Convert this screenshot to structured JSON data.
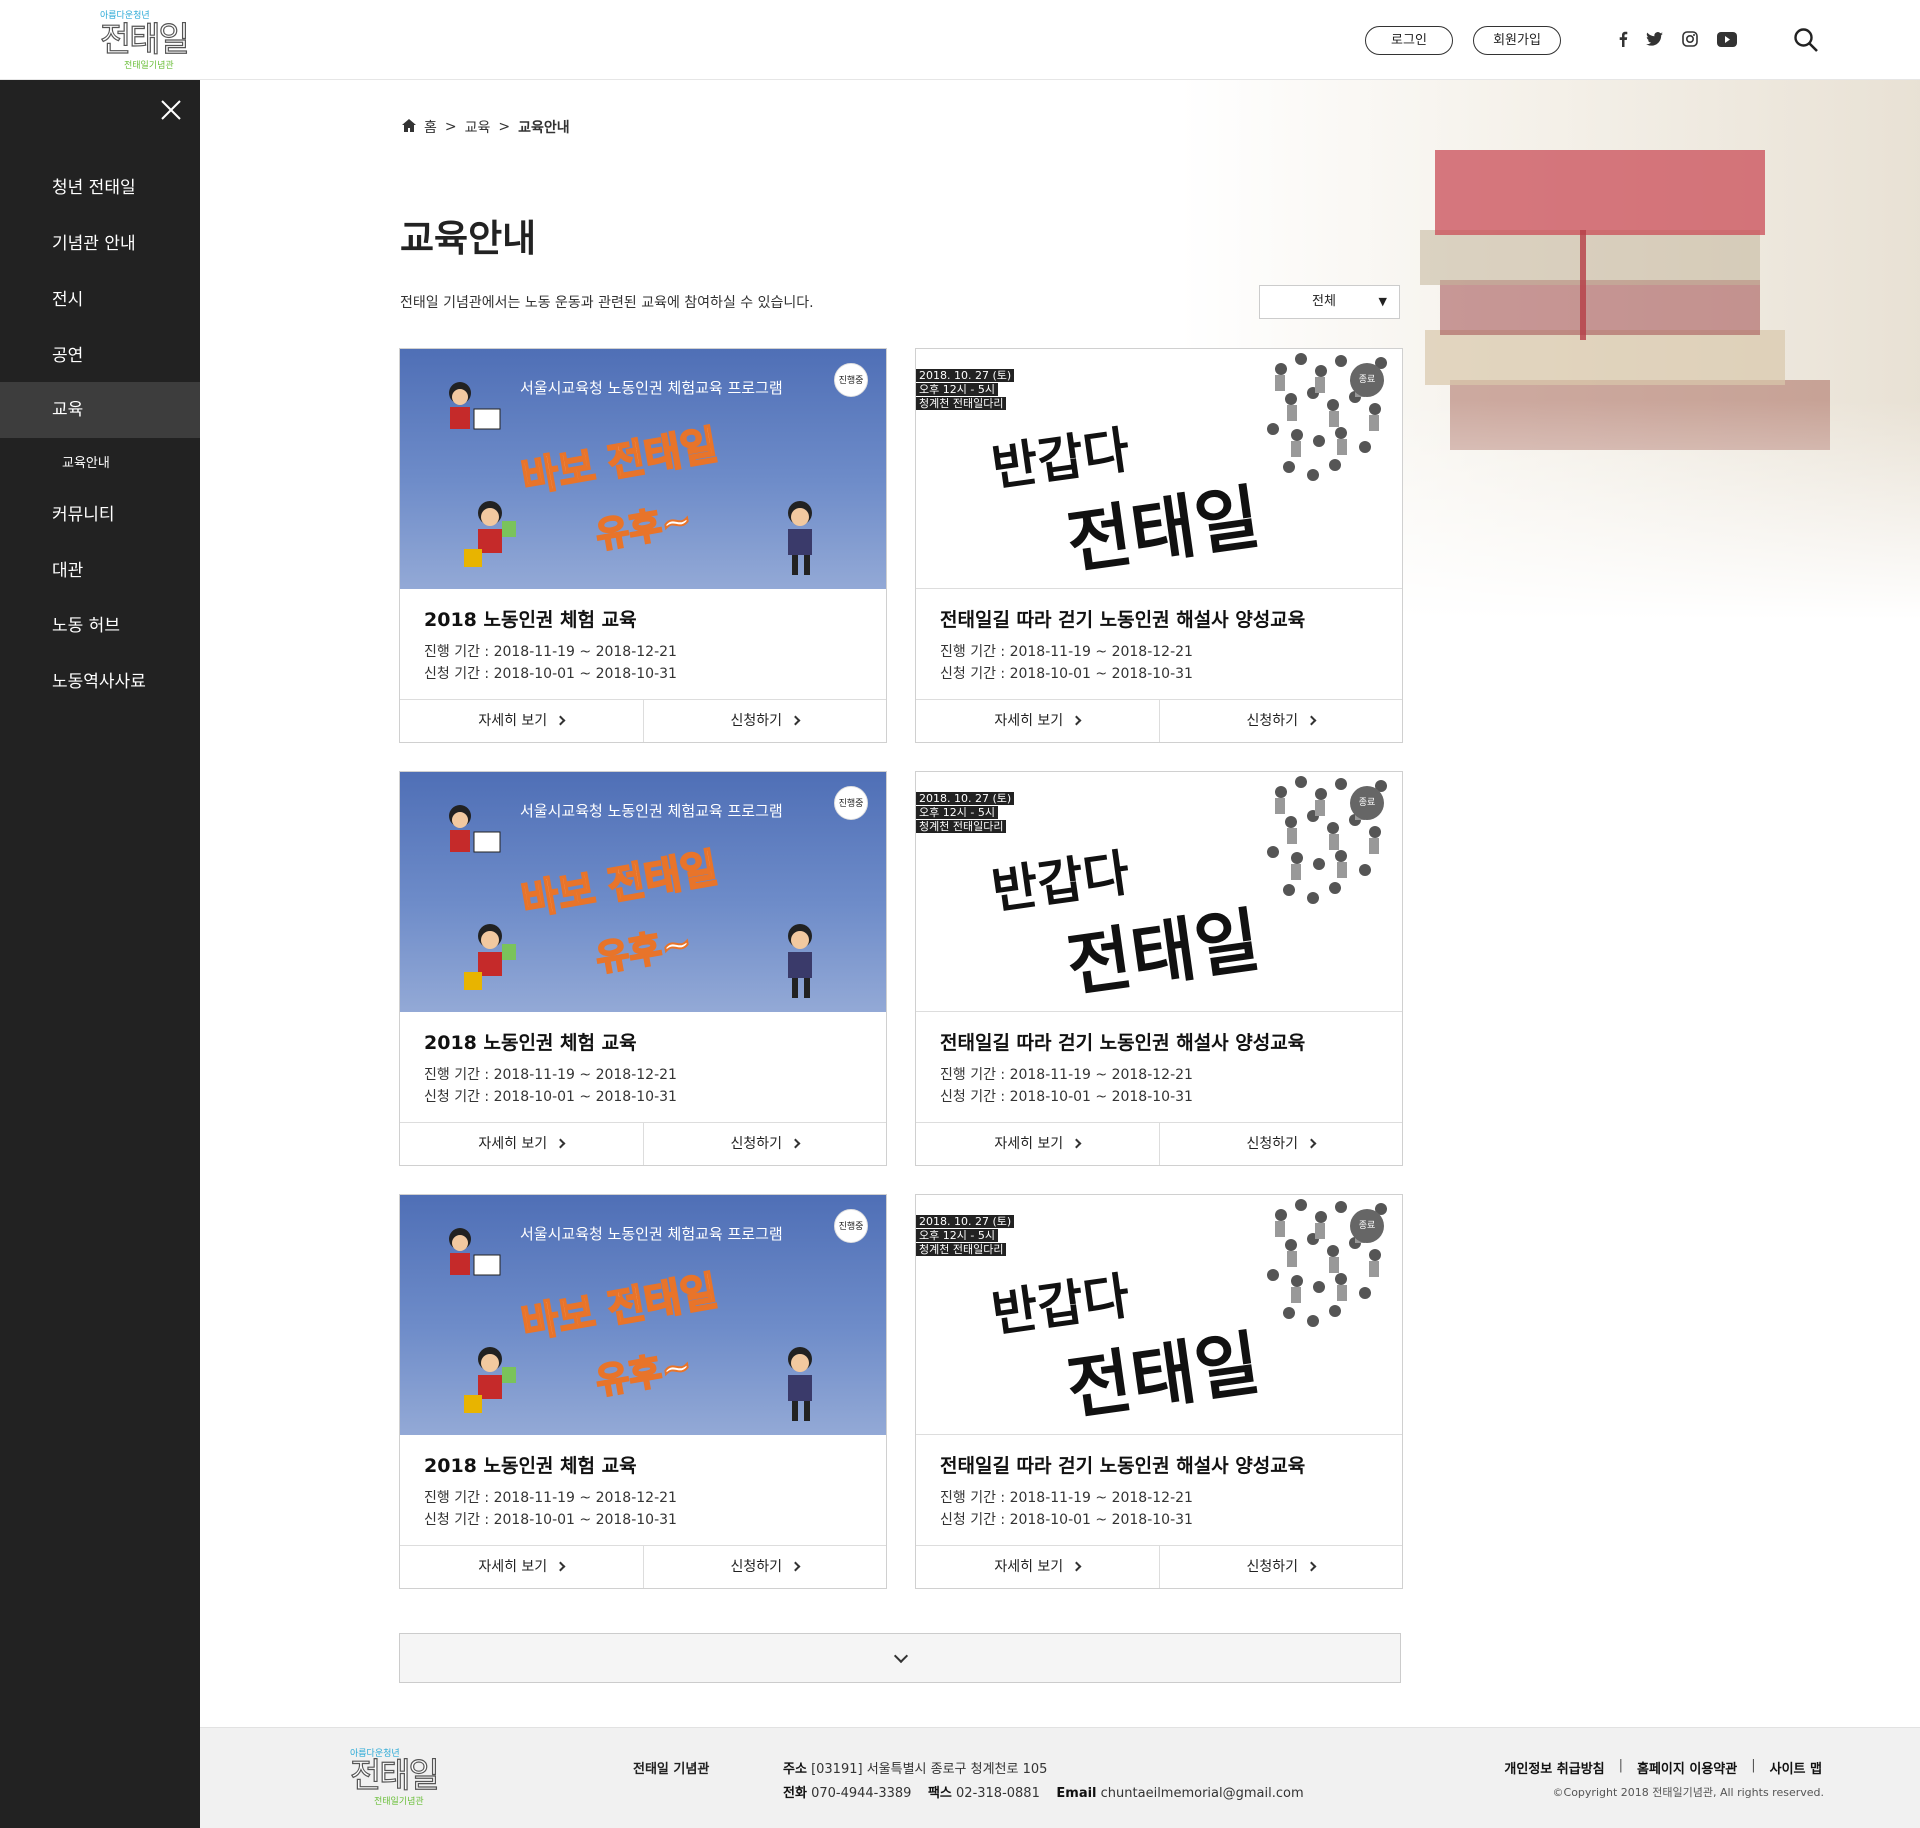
{
  "header": {
    "logo": {
      "small": "아름다운청년",
      "big": "전태일",
      "sub": "전태일기념관"
    },
    "login_label": "로그인",
    "join_label": "회원가입",
    "social": [
      "facebook-icon",
      "twitter-icon",
      "instagram-icon",
      "youtube-icon"
    ]
  },
  "sidebar": {
    "items": [
      {
        "label": "청년 전태일"
      },
      {
        "label": "기념관 안내"
      },
      {
        "label": "전시"
      },
      {
        "label": "공연"
      },
      {
        "label": "교육",
        "active": true
      },
      {
        "label": "커뮤니티"
      },
      {
        "label": "대관"
      },
      {
        "label": "노동 허브"
      },
      {
        "label": "노동역사사료"
      }
    ],
    "sub_item": "교육안내"
  },
  "breadcrumb": {
    "home": "홈",
    "level1": "교육",
    "current": "교육안내",
    "sep": ">"
  },
  "page": {
    "title": "교육안내",
    "description": "전태일 기념관에서는 노동 운동과 관련된 교육에 참여하실 수 있습니다.",
    "filter": "전체"
  },
  "thumb_text": {
    "header": "서울시교육청 노동인권 체험교육 프로그램",
    "art_line1": "바보 전태일",
    "art_line2": "유후~",
    "date_lines": [
      "2018. 10. 27 (토)",
      "오후 12시 - 5시",
      "청계천 전태일다리"
    ],
    "brush1": "반갑다",
    "brush2": "전태일"
  },
  "cards": [
    {
      "title": "2018 노동인권 체험 교육",
      "period": "진행 기간 : 2018-11-19 ~ 2018-12-21",
      "apply": "신청 기간 : 2018-10-01 ~ 2018-10-31",
      "badge": "진행중",
      "detail": "자세히 보기",
      "signup": "신청하기"
    },
    {
      "title": "전태일길 따라 걷기 노동인권 해설사 양성교육",
      "period": "진행 기간 : 2018-11-19 ~ 2018-12-21",
      "apply": "신청 기간 : 2018-10-01 ~ 2018-10-31",
      "badge": "종료",
      "detail": "자세히 보기",
      "signup": "신청하기"
    },
    {
      "title": "2018 노동인권 체험 교육",
      "period": "진행 기간 : 2018-11-19 ~ 2018-12-21",
      "apply": "신청 기간 : 2018-10-01 ~ 2018-10-31",
      "badge": "진행중",
      "detail": "자세히 보기",
      "signup": "신청하기"
    },
    {
      "title": "전태일길 따라 걷기 노동인권 해설사 양성교육",
      "period": "진행 기간 : 2018-11-19 ~ 2018-12-21",
      "apply": "신청 기간 : 2018-10-01 ~ 2018-10-31",
      "badge": "종료",
      "detail": "자세히 보기",
      "signup": "신청하기"
    },
    {
      "title": "2018 노동인권 체험 교육",
      "period": "진행 기간 : 2018-11-19 ~ 2018-12-21",
      "apply": "신청 기간 : 2018-10-01 ~ 2018-10-31",
      "badge": "진행중",
      "detail": "자세히 보기",
      "signup": "신청하기"
    },
    {
      "title": "전태일길 따라 걷기 노동인권 해설사 양성교육",
      "period": "진행 기간 : 2018-11-19 ~ 2018-12-21",
      "apply": "신청 기간 : 2018-10-01 ~ 2018-10-31",
      "badge": "종료",
      "detail": "자세히 보기",
      "signup": "신청하기"
    }
  ],
  "footer": {
    "name": "전태일 기념관",
    "address_label": "주소",
    "address": "[03191] 서울특별시 종로구 청계천로 105",
    "phone_label": "전화",
    "phone": "070-4944-3389",
    "fax_label": "팩스",
    "fax": "02-318-0881",
    "email_label": "Email",
    "email": "chuntaeilmemorial@gmail.com",
    "links": [
      "개인정보 취급방침",
      "홈페이지 이용약관",
      "사이트 맵"
    ],
    "link_sep": "|",
    "copyright": "©Copyright 2018 전태일기념관, All rights reserved."
  },
  "colors": {
    "sidebar_bg": "#222222",
    "sidebar_active": "#3d3d3d",
    "footer_bg": "#f1f1f1",
    "logo_blue": "#2aa9d6",
    "logo_green": "#6bbf3a"
  }
}
